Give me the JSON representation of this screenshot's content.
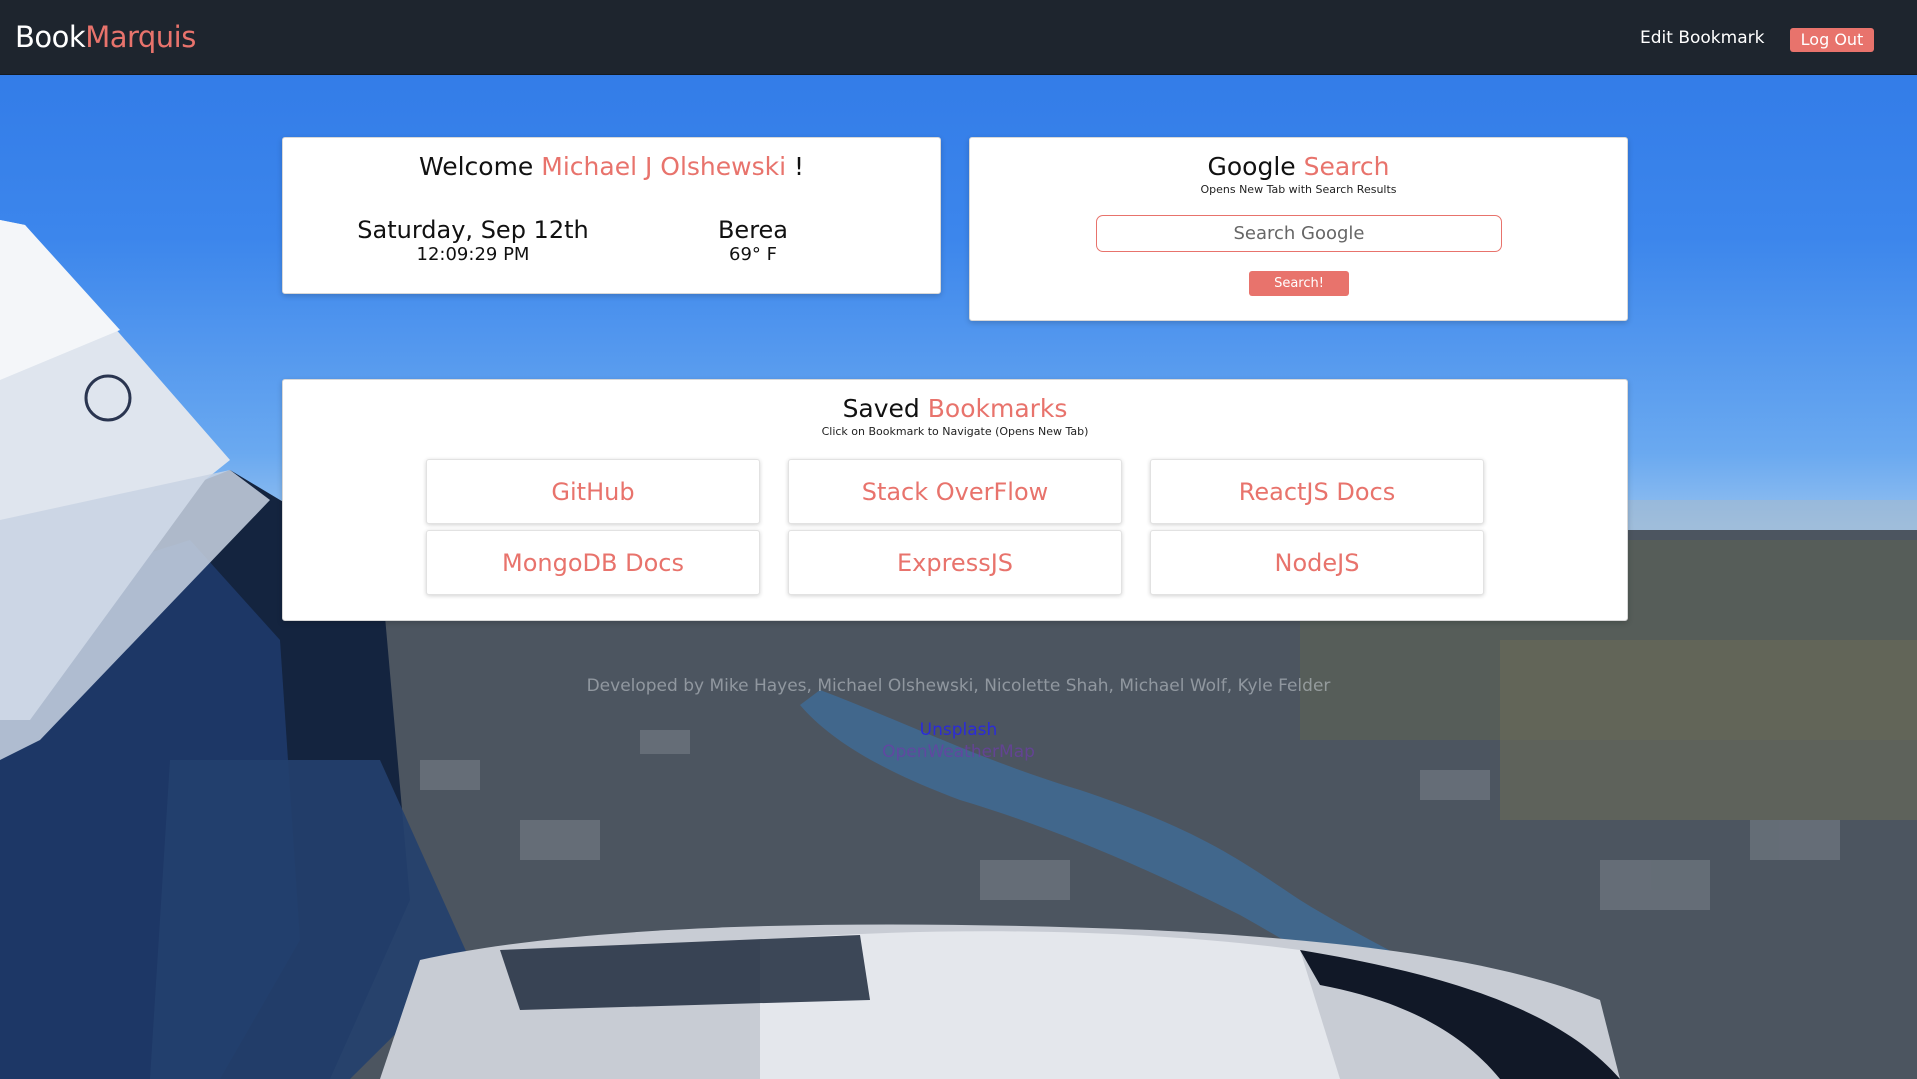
{
  "navbar": {
    "brand_primary": "Book",
    "brand_accent": "Marquis",
    "edit_bookmark_label": "Edit Bookmark",
    "logout_label": "Log Out"
  },
  "welcome": {
    "greeting": "Welcome",
    "user_name": "Michael J Olshewski",
    "suffix": " !",
    "date": "Saturday, Sep 12th",
    "time": "12:09:29 PM",
    "city": "Berea",
    "temperature": "69° F"
  },
  "search": {
    "title_primary": "Google",
    "title_accent": "Search",
    "subtitle": "Opens New Tab with Search Results",
    "placeholder": "Search Google",
    "button_label": "Search!"
  },
  "bookmarks": {
    "title_primary": "Saved",
    "title_accent": "Bookmarks",
    "subtitle": "Click on Bookmark to Navigate (Opens New Tab)",
    "items": [
      {
        "label": "GitHub"
      },
      {
        "label": "Stack OverFlow"
      },
      {
        "label": "ReactJS Docs"
      },
      {
        "label": "MongoDB Docs"
      },
      {
        "label": "ExpressJS"
      },
      {
        "label": "NodeJS"
      }
    ]
  },
  "footer": {
    "developers": "Developed by Mike Hayes, Michael Olshewski, Nicolette Shah, Michael Wolf, Kyle Felder",
    "link_unsplash": "Unsplash",
    "link_openweathermap": "OpenWeatherMap"
  },
  "colors": {
    "accent": "#e8736c",
    "navbar_bg": "#1e252e",
    "card_bg": "#ffffff"
  }
}
